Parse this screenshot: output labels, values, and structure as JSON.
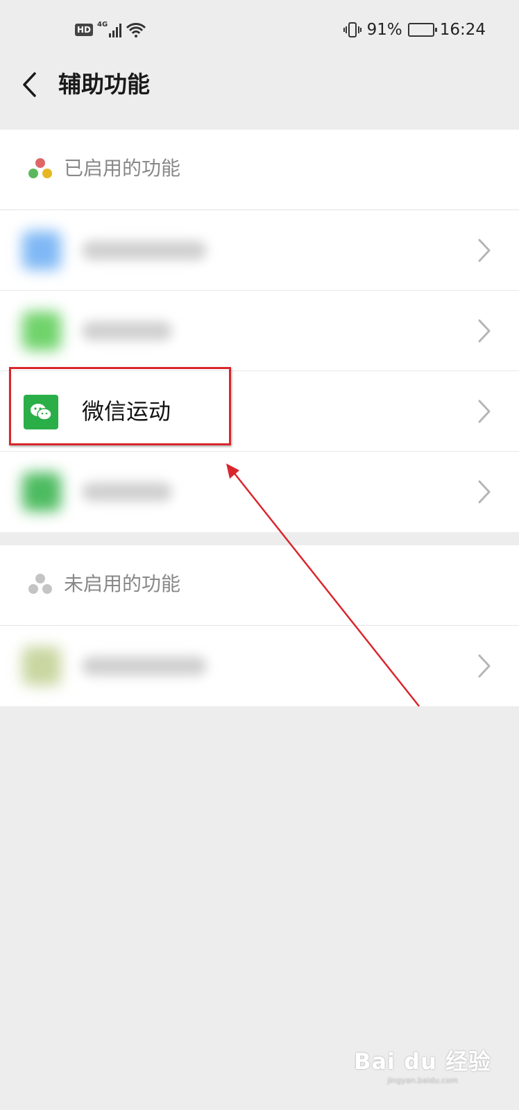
{
  "status_bar": {
    "hd": "HD",
    "network": "4G",
    "battery_percent": "91%",
    "battery_level": 0.91,
    "time": "16:24"
  },
  "nav": {
    "title": "辅助功能"
  },
  "enabled_section": {
    "header": "已启用的功能",
    "items": [
      {
        "label": "",
        "blurred": true,
        "icon_color": "#7fb8f5"
      },
      {
        "label": "",
        "blurred": true,
        "icon_color": "#6fd36a"
      },
      {
        "label": "微信运动",
        "blurred": false,
        "icon_color": "#2aae47"
      },
      {
        "label": "",
        "blurred": true,
        "icon_color": "#4cbb5f"
      }
    ]
  },
  "disabled_section": {
    "header": "未启用的功能",
    "items": [
      {
        "label": "",
        "blurred": true,
        "icon_color": "#c8d6a0"
      }
    ]
  },
  "watermark": {
    "main": "Bai du 经验",
    "sub": "jingyan.baidu.com"
  },
  "colors": {
    "accent_green": "#2aae47",
    "annotation_red": "#d9262c",
    "background": "#ededed"
  }
}
